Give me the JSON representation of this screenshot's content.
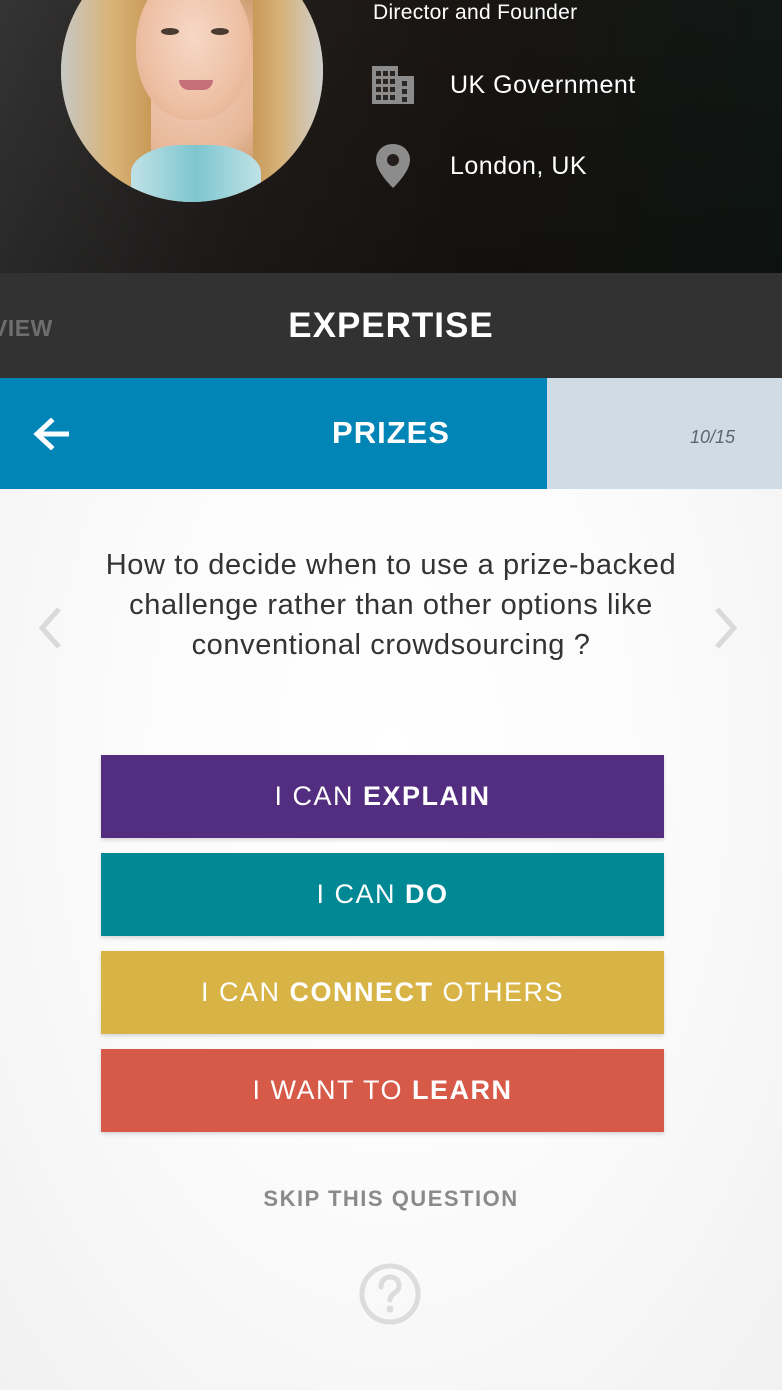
{
  "profile": {
    "role": "Director and Founder",
    "organization": "UK Government",
    "location": "London, UK",
    "icons": {
      "organization": "building-icon",
      "location": "map-pin-icon"
    }
  },
  "tabs": {
    "previous_label": "VIEW",
    "active_label": "EXPERTISE"
  },
  "topic": {
    "title": "PRIZES",
    "progress_text": "10/15",
    "progress_fraction": 0.6667,
    "back_icon": "arrow-left-icon"
  },
  "question": {
    "text": "How to decide when to use a prize-backed challenge rather than other options like conventional crowdsourcing ?"
  },
  "answers": {
    "explain": {
      "prefix": "I CAN",
      "bold": "EXPLAIN",
      "suffix": "",
      "color": "#532e80"
    },
    "do": {
      "prefix": "I CAN",
      "bold": "DO",
      "suffix": "",
      "color": "#008895"
    },
    "connect": {
      "prefix": "I CAN",
      "bold": "CONNECT",
      "suffix": "OTHERS",
      "color": "#d8b446"
    },
    "learn": {
      "prefix": "I WANT TO",
      "bold": "LEARN",
      "suffix": "",
      "color": "#d75a48"
    }
  },
  "skip_label": "SKIP THIS QUESTION",
  "colors": {
    "topic_bar": "#0085b6",
    "progress_rest": "#cfdce6",
    "tab_bar": "#323232"
  },
  "nav": {
    "prev_icon": "chevron-left-icon",
    "next_icon": "chevron-right-icon",
    "help_icon": "question-circle-icon"
  }
}
